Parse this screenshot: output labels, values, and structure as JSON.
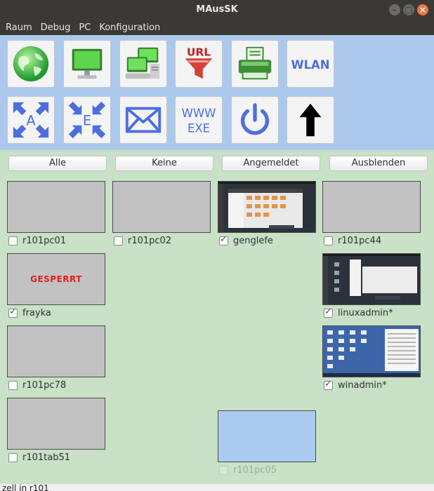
{
  "window": {
    "title": "MAusSK"
  },
  "menu": [
    "Raum",
    "Debug",
    "PC",
    "Konfiguration"
  ],
  "toolbar": {
    "row1": [
      {
        "icon": "globe-icon"
      },
      {
        "icon": "monitor-icon"
      },
      {
        "icon": "computers-icon"
      },
      {
        "icon": "url-filter-icon",
        "text": "URL"
      },
      {
        "icon": "printer-icon"
      },
      {
        "icon": "wlan-icon",
        "text": "WLAN"
      }
    ],
    "row2": [
      {
        "icon": "expand-a-icon",
        "text": "A"
      },
      {
        "icon": "collapse-e-icon",
        "text": "E"
      },
      {
        "icon": "mail-icon"
      },
      {
        "icon": "www-exe-icon",
        "text1": "WWW",
        "text2": "EXE"
      },
      {
        "icon": "power-icon"
      },
      {
        "icon": "up-arrow-icon"
      }
    ]
  },
  "filters": {
    "all": "Alle",
    "none": "Keine",
    "logged_in": "Angemeldet",
    "hide": "Ausblenden"
  },
  "clients": [
    {
      "name": "r101pc01",
      "checked": false
    },
    {
      "name": "r101pc02",
      "checked": false
    },
    {
      "name": "genglefe",
      "checked": true,
      "screen": "linuxmuster desktop"
    },
    {
      "name": "r101pc44",
      "checked": false
    },
    {
      "name": "frayka",
      "checked": true,
      "screen_text": "GESPERRT"
    },
    {
      "name": "linuxadmin*",
      "checked": true,
      "screen": "linuxmuster desktop"
    },
    {
      "name": "r101pc78",
      "checked": false
    },
    {
      "name": "winadmin*",
      "checked": true,
      "screen": "windows desktop"
    },
    {
      "name": "r101tab51",
      "checked": false
    },
    {
      "name": "r101pc05",
      "checked": false,
      "disabled": true
    }
  ],
  "status": {
    "text": "zell in r101"
  },
  "colors": {
    "toolbar_bg": "#acc9ec",
    "content_bg": "#c8e1c7",
    "locked_text": "#e02020",
    "icon_blue": "#4d6de0"
  }
}
